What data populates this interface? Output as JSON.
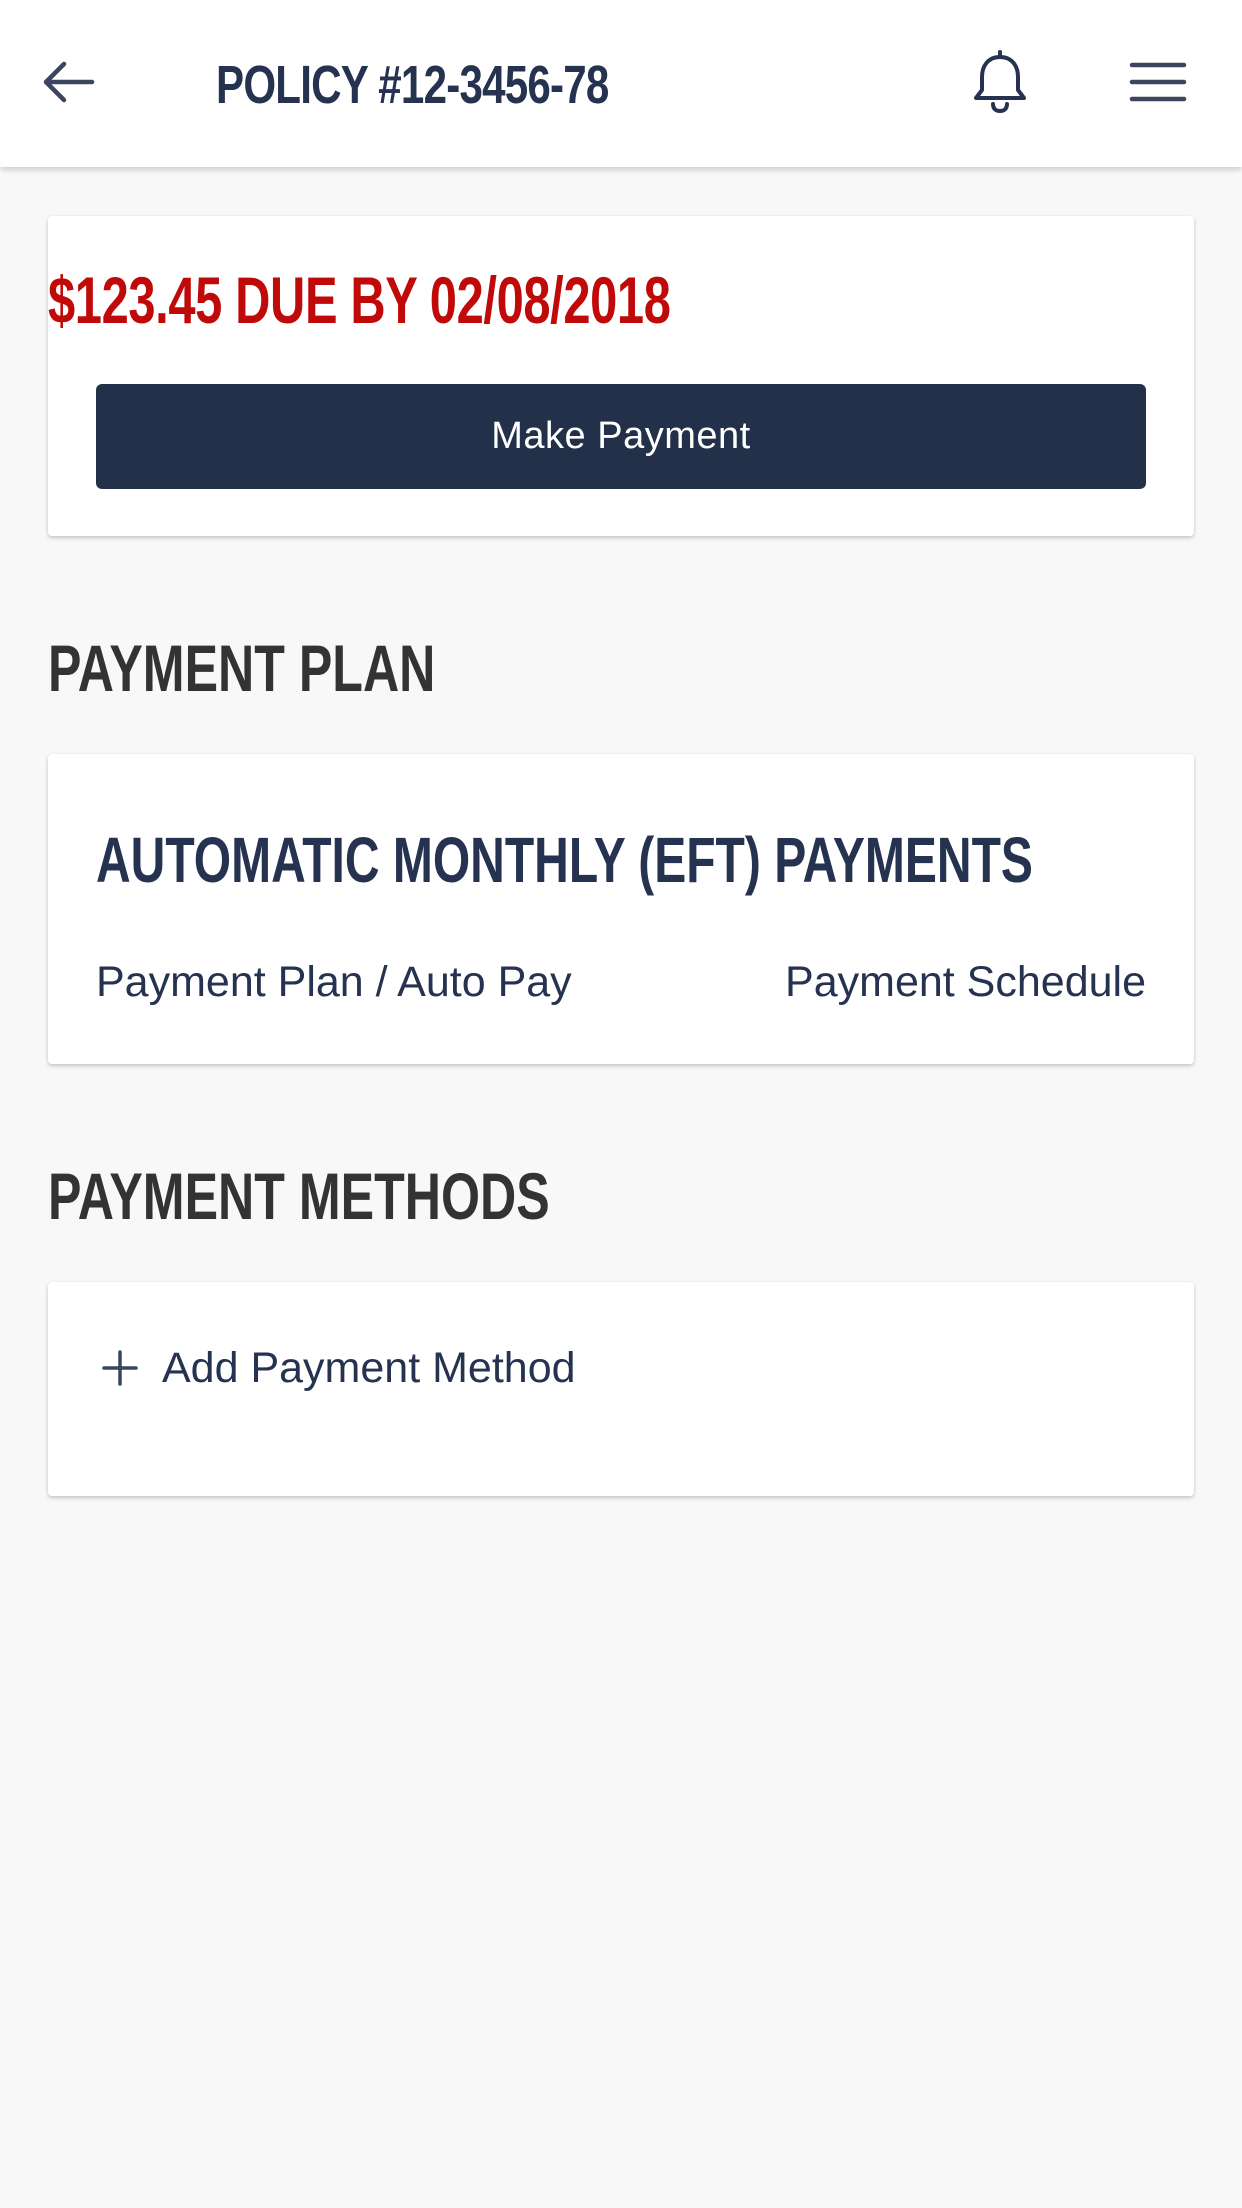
{
  "header": {
    "title": "POLICY #12-3456-78",
    "back_icon": "arrow-left-icon",
    "notification_icon": "bell-icon",
    "menu_icon": "hamburger-menu-icon"
  },
  "due": {
    "text": "$123.45 DUE BY 02/08/2018",
    "button_label": "Make Payment"
  },
  "payment_plan": {
    "heading": "PAYMENT PLAN",
    "title": "AUTOMATIC MONTHLY (EFT) PAYMENTS",
    "left_link": "Payment Plan / Auto Pay",
    "right_link": "Payment Schedule"
  },
  "payment_methods": {
    "heading": "PAYMENT METHODS",
    "add_label": "Add Payment Method",
    "add_icon": "plus-icon"
  },
  "colors": {
    "primary": "#253250",
    "button": "#223049",
    "alert": "#c00a0a",
    "background": "#f8f8f8",
    "heading": "#333333"
  }
}
